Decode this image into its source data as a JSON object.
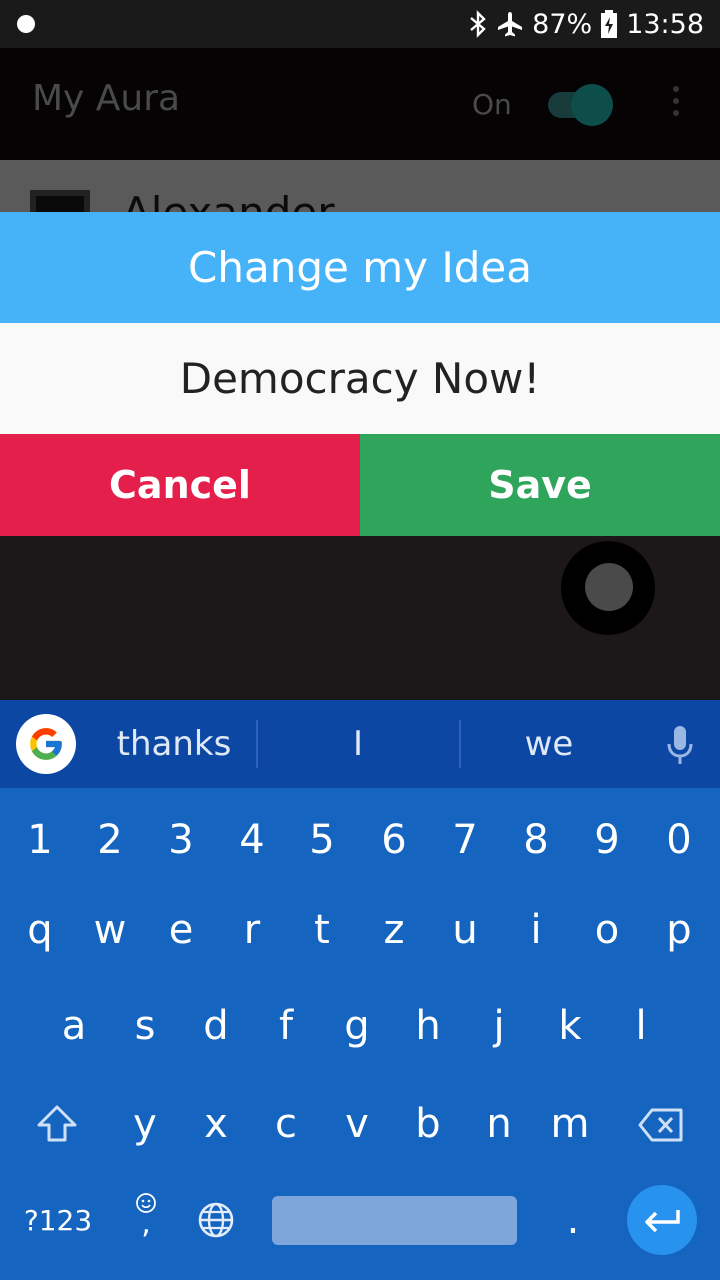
{
  "status_bar": {
    "battery": "87%",
    "time": "13:58"
  },
  "app_bar": {
    "title": "My Aura",
    "toggle_label": "On"
  },
  "list": {
    "first_item_name": "Alexander"
  },
  "dialog": {
    "title": "Change my Idea",
    "idea": "Democracy Now!",
    "cancel_label": "Cancel",
    "save_label": "Save"
  },
  "keyboard": {
    "suggestions": [
      "thanks",
      "I",
      "we"
    ],
    "row_numbers": [
      "1",
      "2",
      "3",
      "4",
      "5",
      "6",
      "7",
      "8",
      "9",
      "0"
    ],
    "row1": [
      "q",
      "w",
      "e",
      "r",
      "t",
      "z",
      "u",
      "i",
      "o",
      "p"
    ],
    "row2": [
      "a",
      "s",
      "d",
      "f",
      "g",
      "h",
      "j",
      "k",
      "l"
    ],
    "row3": [
      "y",
      "x",
      "c",
      "v",
      "b",
      "n",
      "m"
    ],
    "symbols_label": "?123",
    "comma": ",",
    "period": "."
  },
  "colors": {
    "dialog_header": "#46b3f8",
    "cancel": "#e51f4c",
    "save": "#2ea55a",
    "keyboard": "#1565c0"
  }
}
